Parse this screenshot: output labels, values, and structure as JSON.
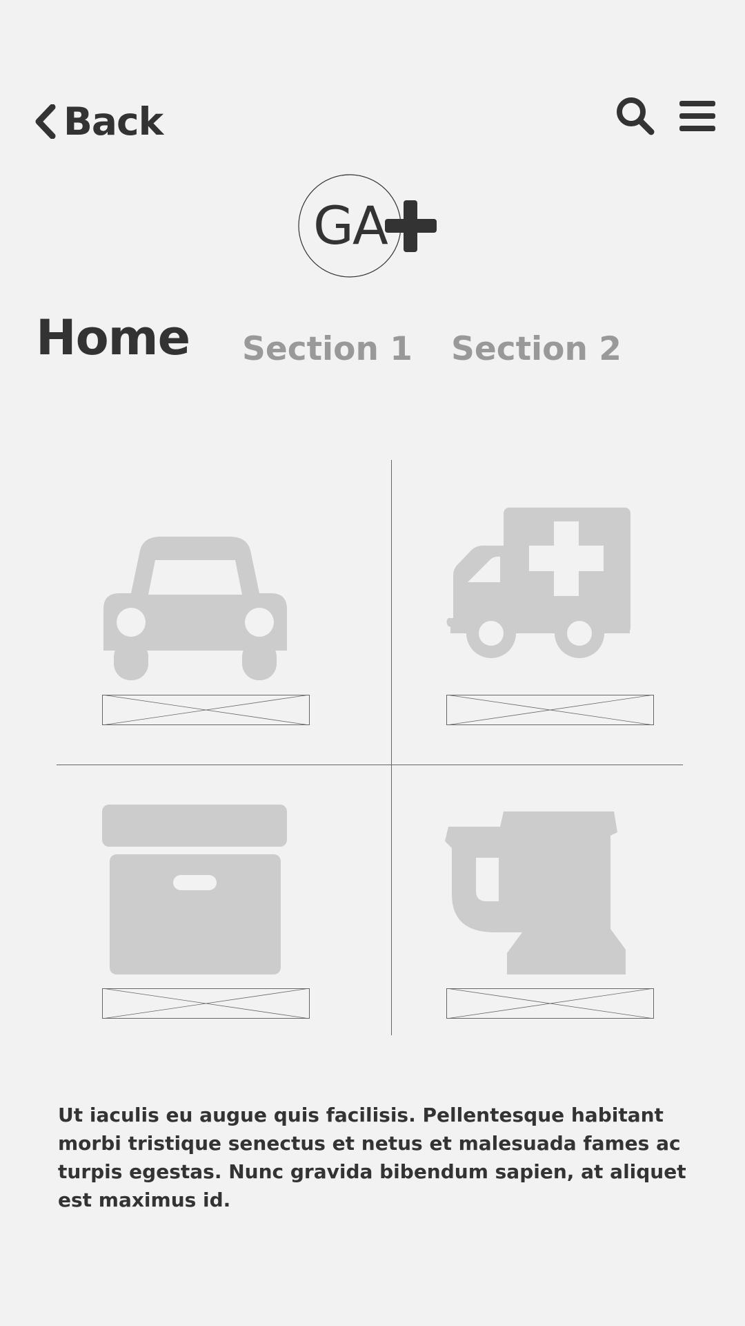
{
  "header": {
    "back_label": "Back",
    "icons": {
      "back": "chevron-left-icon",
      "search": "search-icon",
      "menu": "hamburger-menu-icon"
    }
  },
  "logo": {
    "text": "GA",
    "icon": "plus-icon"
  },
  "tabs": [
    {
      "label": "Home",
      "active": true
    },
    {
      "label": "Section 1",
      "active": false
    },
    {
      "label": "Section 2",
      "active": false
    }
  ],
  "tiles": [
    {
      "icon": "car-icon"
    },
    {
      "icon": "ambulance-icon"
    },
    {
      "icon": "archive-box-icon"
    },
    {
      "icon": "mug-icon"
    }
  ],
  "description": "Ut iaculis eu augue quis facilisis. Pellentesque habitant morbi tristique senectus et netus et malesuada fames ac turpis egestas. Nunc gravida bibendum sapien, at aliquet est maximus id.",
  "colors": {
    "background": "#f2f2f2",
    "text": "#333333",
    "muted": "#999999",
    "icon": "#cccccc"
  }
}
